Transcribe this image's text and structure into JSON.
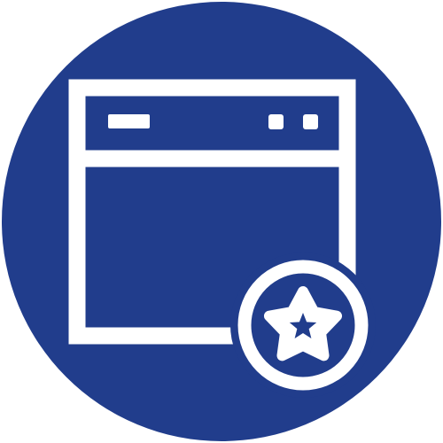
{
  "icon": {
    "name": "browser-window-favorite-icon",
    "colors": {
      "background": "#ffffff",
      "circle": "#213d8c",
      "line": "#ffffff"
    },
    "parts": [
      "browser-window-icon",
      "star-badge-icon"
    ]
  }
}
